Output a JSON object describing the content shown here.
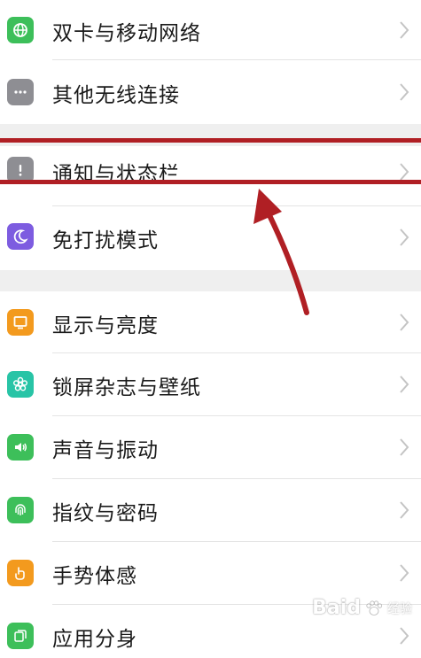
{
  "settings": {
    "items": [
      {
        "label": "双卡与移动网络",
        "icon": "globe-icon",
        "color": "#3dbf5a"
      },
      {
        "label": "其他无线连接",
        "icon": "more-dots-icon",
        "color": "#8e8e93"
      },
      {
        "label": "通知与状态栏",
        "icon": "exclamation-icon",
        "color": "#8e8e93"
      },
      {
        "label": "免打扰模式",
        "icon": "moon-icon",
        "color": "#7d5ce0"
      },
      {
        "label": "显示与亮度",
        "icon": "display-icon",
        "color": "#f39a1e"
      },
      {
        "label": "锁屏杂志与壁纸",
        "icon": "flower-icon",
        "color": "#28c4a6"
      },
      {
        "label": "声音与振动",
        "icon": "speaker-icon",
        "color": "#3dbf5a"
      },
      {
        "label": "指纹与密码",
        "icon": "fingerprint-icon",
        "color": "#3dbf5a"
      },
      {
        "label": "手势体感",
        "icon": "gesture-icon",
        "color": "#f39a1e"
      },
      {
        "label": "应用分身",
        "icon": "app-clone-icon",
        "color": "#3dbf5a"
      }
    ]
  },
  "annotation": {
    "highlight_color": "#b01f24",
    "arrow_color": "#b01f24"
  },
  "watermark": {
    "text": "Baid",
    "sub": "经验"
  }
}
